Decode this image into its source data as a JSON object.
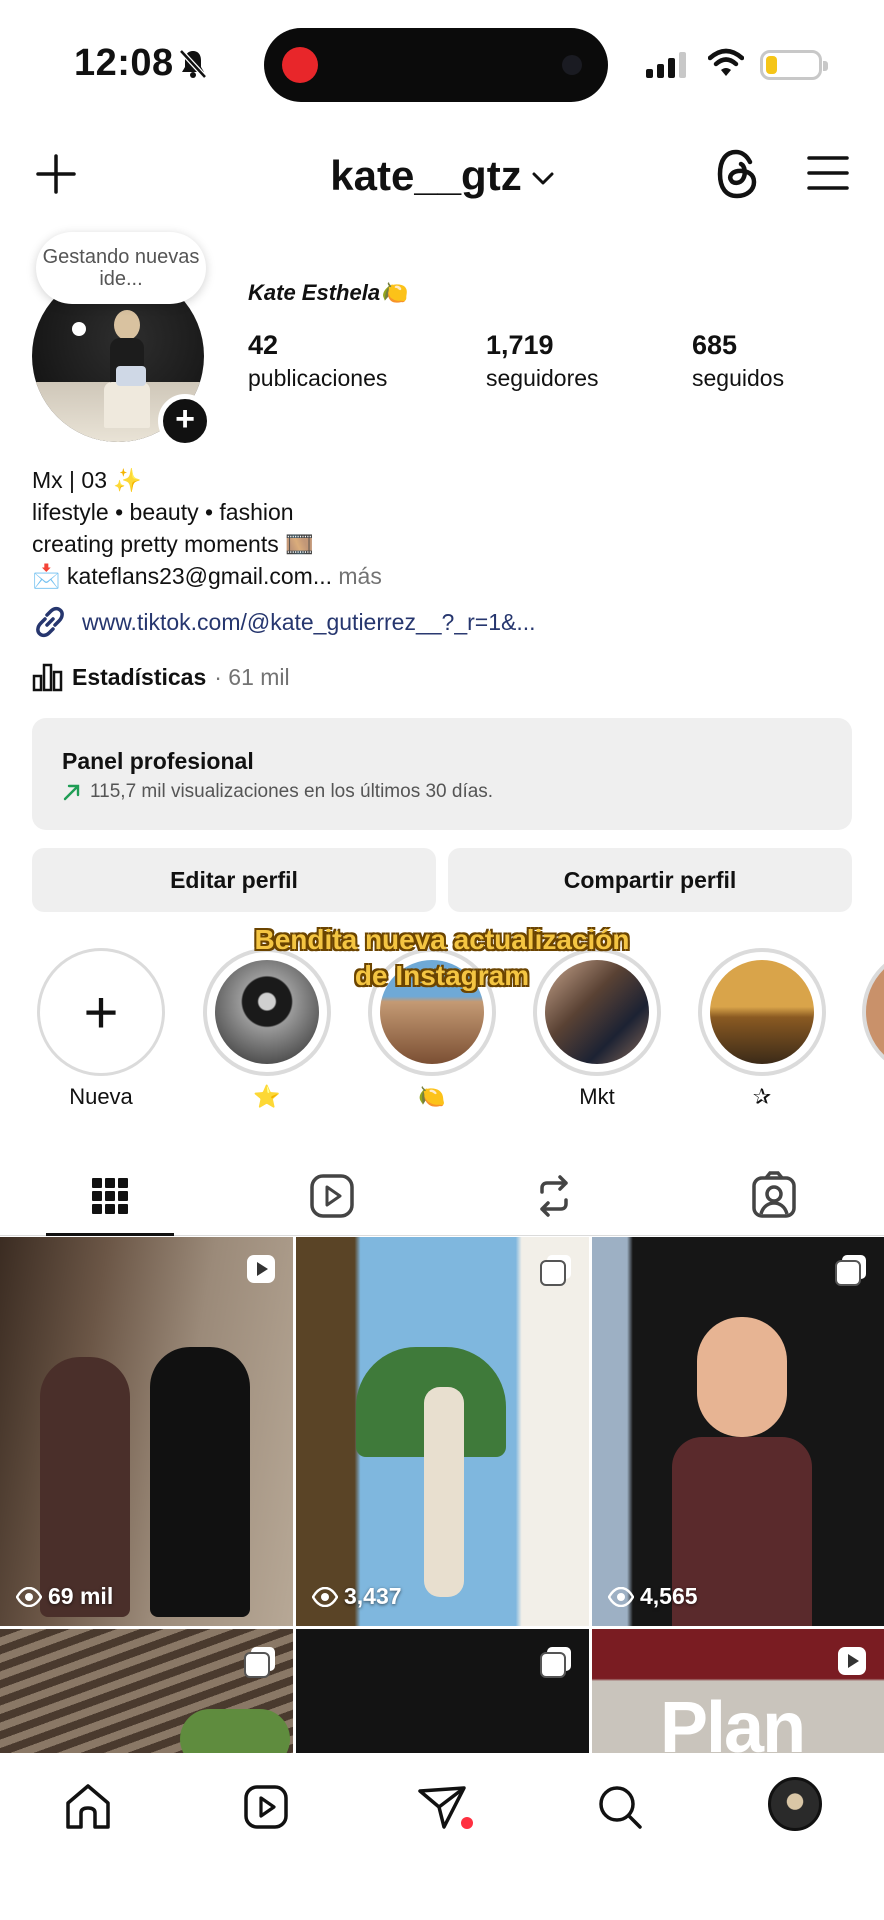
{
  "status_bar": {
    "time": "12:08",
    "icons": [
      "bell-slash-icon",
      "signal-icon",
      "wifi-icon",
      "battery-icon"
    ],
    "battery_level": 0.2
  },
  "header": {
    "username": "kate__gtz",
    "icons": [
      "plus-icon",
      "chevron-down-icon",
      "threads-icon",
      "menu-icon"
    ]
  },
  "profile": {
    "note": "Gestando nuevas ide...",
    "full_name": "Kate Esthela🍋",
    "stats": [
      {
        "value": "42",
        "label": "publicaciones"
      },
      {
        "value": "1,719",
        "label": "seguidores"
      },
      {
        "value": "685",
        "label": "seguidos"
      }
    ],
    "bio": {
      "line1": "Mx | 03 ✨",
      "line2": "lifestyle • beauty • fashion",
      "line3": "creating pretty moments 🎞️",
      "line4": "📩 kateflans23@gmail.com...",
      "more": "más"
    },
    "link": "www.tiktok.com/@kate_gutierrez__?_r=1&...",
    "insights_label": "Estadísticas",
    "insights_value": "· 61 mil"
  },
  "dashboard": {
    "title": "Panel profesional",
    "subtitle": "115,7 mil visualizaciones en los últimos 30 días."
  },
  "buttons": {
    "edit": "Editar perfil",
    "share": "Compartir perfil"
  },
  "overlay_caption": {
    "line1": "Bendita nueva actualización",
    "line2": "de Instagram"
  },
  "highlights": [
    {
      "label": "Nueva"
    },
    {
      "label": "⭐"
    },
    {
      "label": "🍋"
    },
    {
      "label": "Mkt"
    },
    {
      "label": "✰"
    }
  ],
  "tabs": [
    "grid-icon",
    "reels-icon",
    "reposts-icon",
    "tagged-icon"
  ],
  "posts": [
    {
      "views": "69 mil",
      "badge": "reel-icon"
    },
    {
      "views": "3,437",
      "badge": "carousel-icon"
    },
    {
      "views": "4,565",
      "badge": "carousel-icon"
    },
    {
      "views": "",
      "badge": "carousel-icon"
    },
    {
      "views": "",
      "badge": "carousel-icon"
    },
    {
      "views": "",
      "badge": "reel-icon",
      "text": "Plan"
    }
  ],
  "bottom_nav": [
    "home-icon",
    "reels-icon",
    "direct-icon",
    "search-icon",
    "profile-avatar"
  ],
  "colors": {
    "accent_red": "#ff3040",
    "link": "#26366e",
    "panel_bg": "#efefef"
  }
}
